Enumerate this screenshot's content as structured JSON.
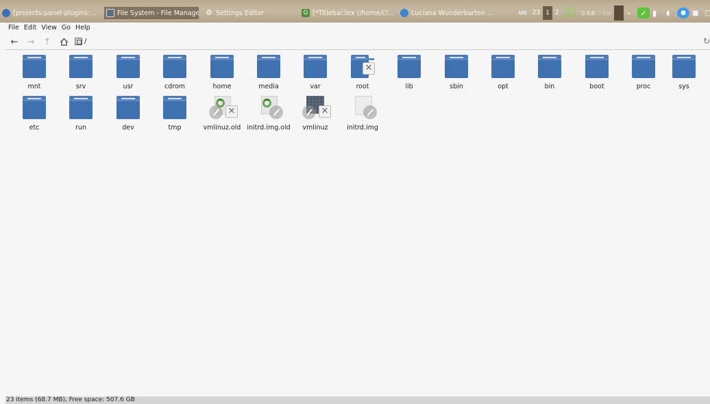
{
  "taskbar": {
    "tasks": [
      {
        "label": "[projects:panel-plugins:...",
        "icon": "globe-icon",
        "color": "#3b6fb6"
      },
      {
        "label": "File System - File Manager",
        "icon": "file-manager-icon",
        "color": "#5a6e86"
      },
      {
        "label": "Settings Editor",
        "icon": "gear-icon",
        "color": "#8c7d68"
      },
      {
        "label": "[*Titlebar.tex (/home/cl...",
        "icon": "editor-icon",
        "color": "#4f8f3a"
      },
      {
        "label": "Luciana Wunderbarten ...",
        "icon": "chat-icon",
        "color": "#3b86d6"
      }
    ],
    "keyboard_layout": "us",
    "workspace_number": "23",
    "workspaces": [
      "1",
      "2"
    ],
    "cpu_top": "29.8",
    "cpu_bottom": "46.0",
    "net_down": "0 KiB",
    "net_up": "0 KiB"
  },
  "menubar": [
    "File",
    "Edit",
    "View",
    "Go",
    "Help"
  ],
  "toolbar": {
    "back_icon": "arrow-left-icon",
    "forward_icon": "arrow-right-icon",
    "up_icon": "arrow-up-icon",
    "home_icon": "home-icon",
    "path": "/",
    "reload_icon": "reload-icon"
  },
  "items": [
    {
      "label": "mnt",
      "type": "folder"
    },
    {
      "label": "srv",
      "type": "folder"
    },
    {
      "label": "usr",
      "type": "folder"
    },
    {
      "label": "cdrom",
      "type": "folder"
    },
    {
      "label": "home",
      "type": "folder"
    },
    {
      "label": "media",
      "type": "folder"
    },
    {
      "label": "var",
      "type": "folder"
    },
    {
      "label": "root",
      "type": "folder-locked"
    },
    {
      "label": "lib",
      "type": "folder"
    },
    {
      "label": "sbin",
      "type": "folder"
    },
    {
      "label": "opt",
      "type": "folder"
    },
    {
      "label": "bin",
      "type": "folder"
    },
    {
      "label": "boot",
      "type": "folder"
    },
    {
      "label": "proc",
      "type": "folder"
    },
    {
      "label": "sys",
      "type": "folder"
    },
    {
      "label": "etc",
      "type": "folder"
    },
    {
      "label": "run",
      "type": "folder"
    },
    {
      "label": "dev",
      "type": "folder"
    },
    {
      "label": "tmp",
      "type": "folder"
    },
    {
      "label": "vmlinuz.old",
      "type": "package-link-broken"
    },
    {
      "label": "initrd.img.old",
      "type": "package-link"
    },
    {
      "label": "vmlinuz",
      "type": "binary-link-broken"
    },
    {
      "label": "initrd.img",
      "type": "blank-link"
    }
  ],
  "status": "23 items (68.7 MB), Free space: 507.6 GB",
  "colors": {
    "folder_blue": "#3f70b0",
    "cpu_green": "#7fd13b",
    "status_bg": "#d4d4d4"
  }
}
